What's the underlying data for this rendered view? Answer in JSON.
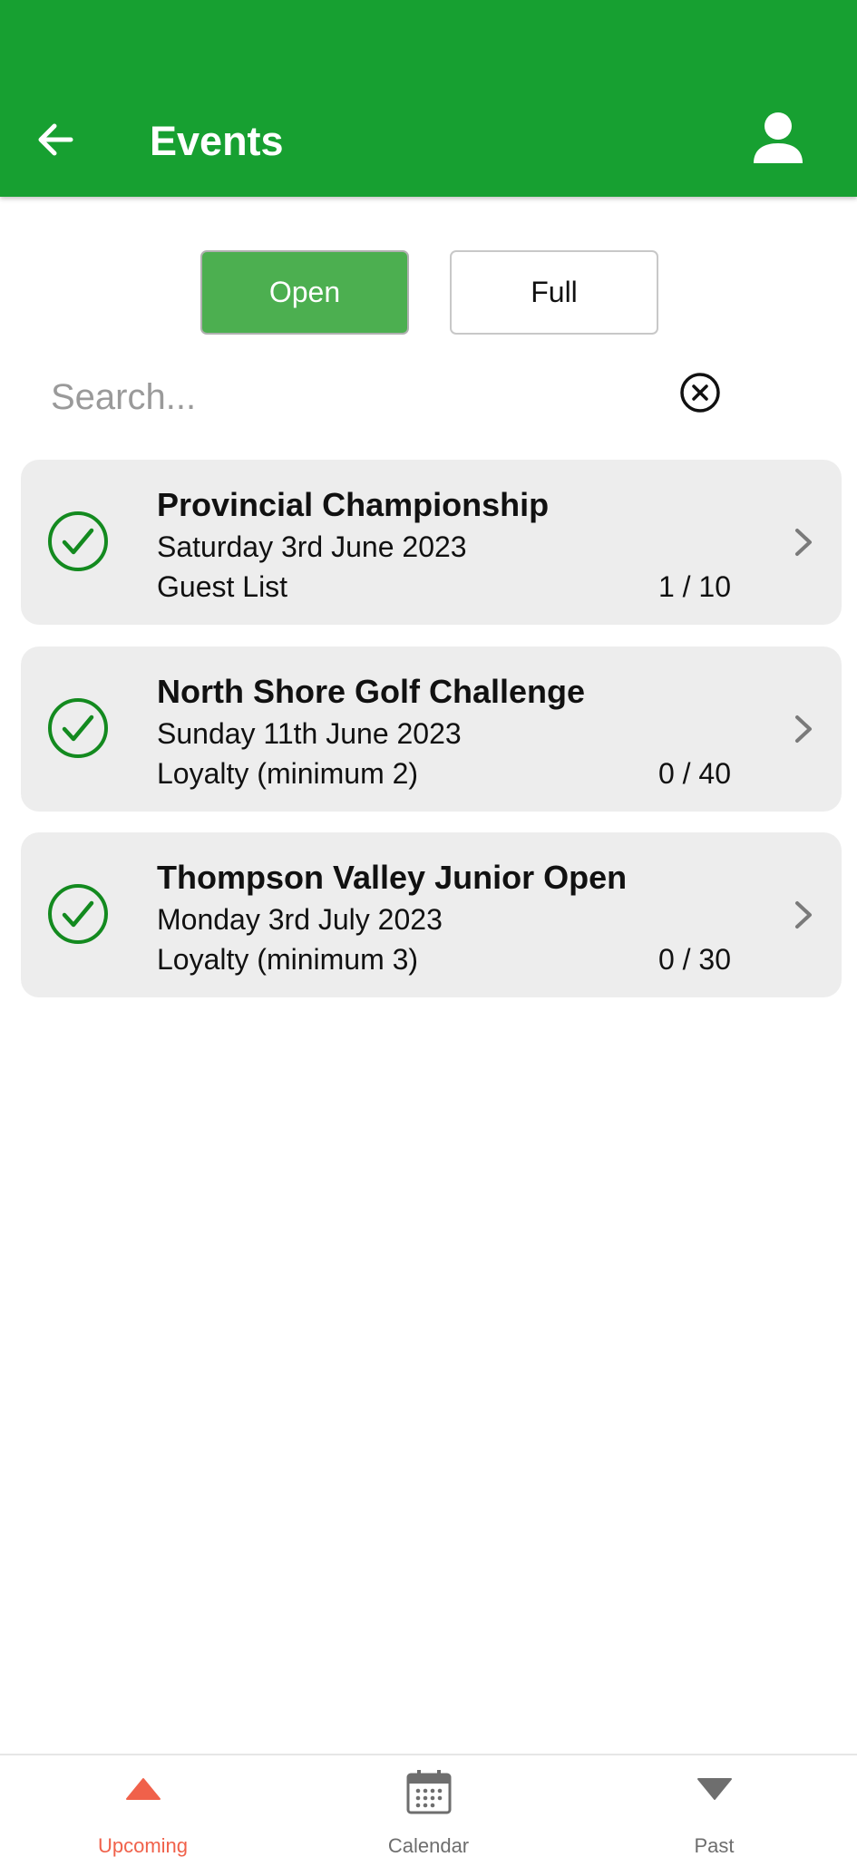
{
  "header": {
    "title": "Events",
    "background_color": "#17a031",
    "back_icon": "arrow-left-icon",
    "profile_icon": "person-icon"
  },
  "filters": {
    "open_label": "Open",
    "full_label": "Full",
    "active": "Open",
    "active_color": "#4caf50"
  },
  "search": {
    "placeholder": "Search...",
    "value": "",
    "clear_icon": "clear-circle-icon"
  },
  "events": [
    {
      "title": "Provincial Championship",
      "date": "Saturday 3rd June 2023",
      "type": "Guest List",
      "count": "1 / 10",
      "status_icon": "check-circle-icon"
    },
    {
      "title": "North Shore Golf Challenge",
      "date": "Sunday 11th June 2023",
      "type": "Loyalty (minimum 2)",
      "count": "0 / 40",
      "status_icon": "check-circle-icon"
    },
    {
      "title": "Thompson Valley Junior Open",
      "date": "Monday 3rd July 2023",
      "type": "Loyalty (minimum 3)",
      "count": "0 / 30",
      "status_icon": "check-circle-icon"
    }
  ],
  "bottom_nav": {
    "items": [
      {
        "label": "Upcoming",
        "icon": "triangle-up-icon",
        "active": true
      },
      {
        "label": "Calendar",
        "icon": "calendar-icon",
        "active": false
      },
      {
        "label": "Past",
        "icon": "triangle-down-icon",
        "active": false
      }
    ],
    "active_color": "#f0614a",
    "inactive_color": "#6e6e6e"
  }
}
